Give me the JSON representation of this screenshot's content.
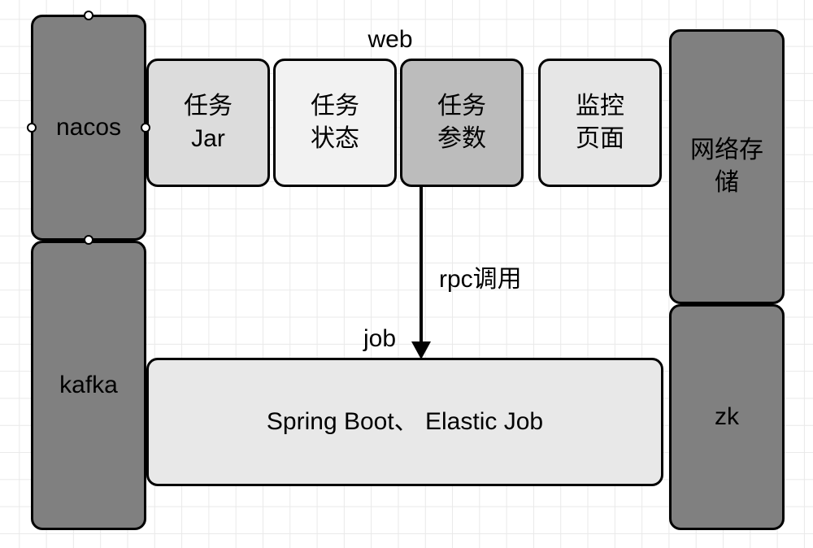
{
  "left": {
    "top": "nacos",
    "bottom": "kafka"
  },
  "right": {
    "top": "网络存\n储",
    "bottom": "zk"
  },
  "web_label": "web",
  "web": {
    "jar": "任务\nJar",
    "status": "任务\n状态",
    "params": "任务\n参数",
    "monitor": "监控\n页面"
  },
  "rpc_label": "rpc调用",
  "job_label": "job",
  "job_box": "Spring Boot、 Elastic Job"
}
